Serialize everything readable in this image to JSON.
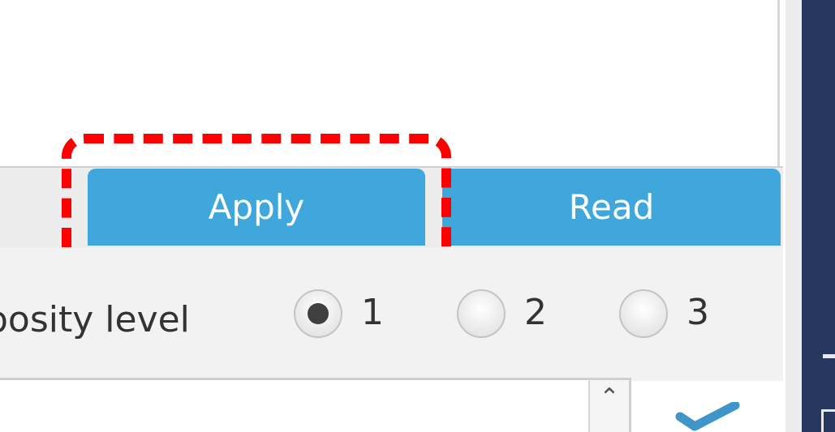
{
  "toolbar": {
    "apply_label": "Apply",
    "read_label": "Read"
  },
  "settings": {
    "verbosity_label": "bosity level",
    "verbosity_options": [
      "1",
      "2",
      "3"
    ],
    "selected_level": "1"
  },
  "colors": {
    "button_bg": "#3fa7db",
    "button_text": "#ffffff",
    "highlight": "#ff0000",
    "dark_panel": "#28375f"
  },
  "icons": {
    "scroll_up": "chevron-up-icon",
    "check": "check-icon"
  }
}
